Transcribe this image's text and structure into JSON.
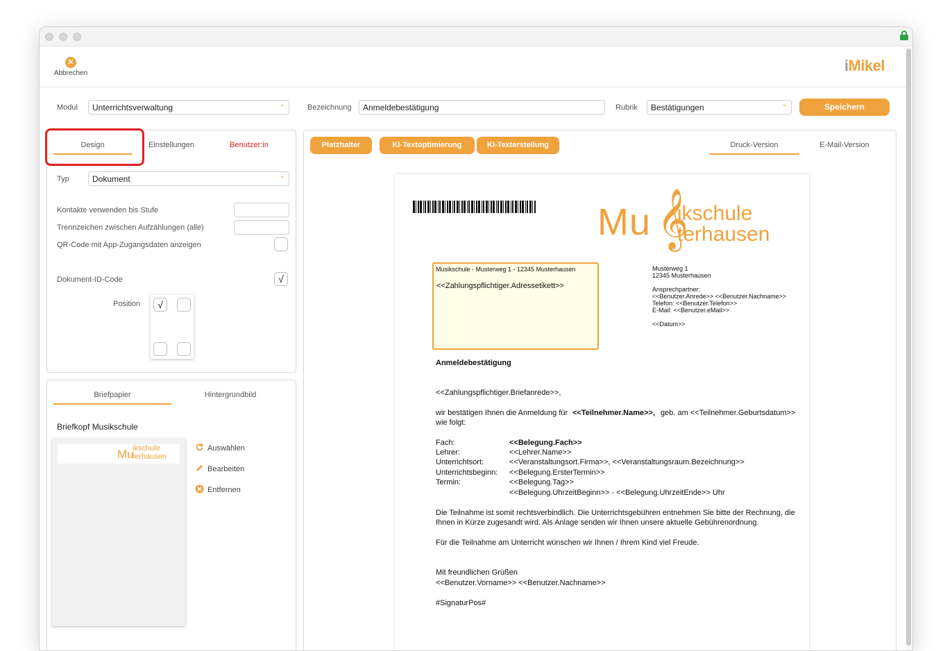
{
  "toolbar": {
    "cancel_label": "Abbrechen",
    "brand_prefix": "i",
    "brand_rest": "Mikel"
  },
  "form": {
    "modul_label": "Modul",
    "modul_value": "Unterrichtsverwaltung",
    "bezeichnung_label": "Bezeichnung",
    "bezeichnung_value": "Anmeldebestätigung",
    "rubrik_label": "Rubrik",
    "rubrik_value": "Bestätigungen",
    "save_label": "Speichern"
  },
  "left_tabs": {
    "design": "Design",
    "einstellungen": "Einstellungen",
    "benutzer": "Benutzer:in"
  },
  "settings": {
    "typ_label": "Typ",
    "typ_value": "Dokument",
    "kontakte_label": "Kontakte verwenden bis Stufe",
    "trennzeichen_label": "Trennzeichen zwischen Aufzählungen (alle)",
    "qr_label": "QR-Code mit App-Zugangsdaten anzeigen",
    "docid_label": "Dokument-ID-Code",
    "docid_check": "√",
    "position_label": "Position",
    "position_check": "√"
  },
  "brief_tabs": {
    "briefpapier": "Briefpapier",
    "hintergrund": "Hintergrundbild"
  },
  "briefkopf": {
    "title": "Briefkopf Musikschule",
    "actions": [
      "Auswählen",
      "Bearbeiten",
      "Entfernen"
    ],
    "thumb_logo_line1": "ikschule",
    "thumb_logo_prefix": "Mu",
    "thumb_logo_line2": "terhausen"
  },
  "editor_buttons": {
    "platzhalter": "Platzhalter",
    "ki_opt": "KI-Textoptimierung",
    "ki_erst": "KI-Texterstellung"
  },
  "version_tabs": {
    "druck": "Druck-Version",
    "email": "E-Mail-Version"
  },
  "document": {
    "logo_prefix": "Mu",
    "logo_line1": "ikschule",
    "logo_line2": "terhausen",
    "sender_line": "Musikschule - Musterweg 1 - 12345 Musterhausen",
    "address_placeholder": "<<Zahlungspflichtiger.Adressetikett>>",
    "right_info": [
      "Musterweg 1",
      "12345 Musterhausen",
      "",
      "Ansprechpartner:",
      "<<Benutzer.Anrede>> <<Benutzer.Nachname>>",
      "Telefon: <<Benutzer.Telefon>>",
      "E-Mail: <<Benutzer.eMail>>",
      "",
      "<<Datum>>"
    ],
    "subject": "Anmeldebestätigung",
    "salutation": "<<Zahlungspflichtiger.Briefanrede>>,",
    "intro_a": "wir bestätigen Ihnen die Anmeldung für",
    "intro_bold": "<<Teilnehmer.Name>>,",
    "intro_b": "geb. am <<Teilnehmer.Geburtsdatum>>",
    "intro_c": "wie folgt:",
    "details": [
      {
        "k": "Fach:",
        "v": "<<Belegung.Fach>>",
        "bold": true
      },
      {
        "k": "Lehrer:",
        "v": "<<Lehrer.Name>>"
      },
      {
        "k": "Unterrichtsort:",
        "v": "<<Veranstaltungsort.Firma>>, <<Veranstaltungsraum.Bezeichnung>>"
      },
      {
        "k": "Unterrichtsbeginn:",
        "v": "<<Belegung.ErsterTermin>>"
      },
      {
        "k": "Termin:",
        "v": "<<Belegung.Tag>>"
      },
      {
        "k": "",
        "v": "<<Belegung.UhrzeitBeginn>> - <<Belegung.UhrzeitEnde>> Uhr"
      }
    ],
    "para1_a": "Die Teilnahme ist somit rechtsverbindlich. Die Unterrichtsgebühren entnehmen Sie bitte der Rechnung, die",
    "para1_b": "Ihnen in Kürze zugesandt wird. Als Anlage senden wir Ihnen unsere aktuelle Gebührenordnung.",
    "para2": "Für die Teilnahme am Unterricht wünschen wir Ihnen / Ihrem Kind viel Freude.",
    "closing": "Mit freundlichen Grüßen",
    "signer": "<<Benutzer.Vorname>> <<Benutzer.Nachname>>",
    "signature": "#SignaturPos#"
  },
  "colors": {
    "accent": "#f0a23d",
    "danger": "#e02020"
  }
}
